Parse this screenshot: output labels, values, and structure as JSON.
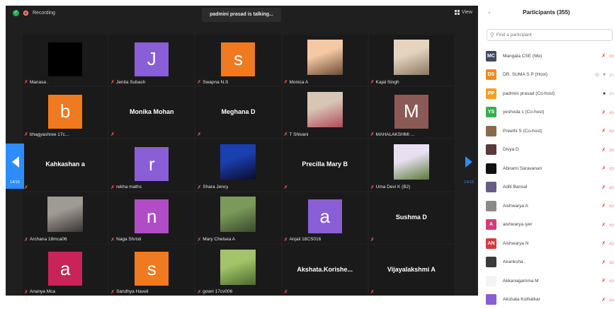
{
  "topbar": {
    "recording": "Recording",
    "talking": "padmini prasad is talking...",
    "view": "View"
  },
  "nav": {
    "left_page": "14/15",
    "right_page": "14/15"
  },
  "tiles": [
    {
      "name": "Manasa .",
      "kind": "avatar",
      "bg": "#000000",
      "letter": ""
    },
    {
      "name": "Jenita Subash",
      "kind": "avatar",
      "bg": "#8a5ed6",
      "letter": "J"
    },
    {
      "name": "Swapna N.S",
      "kind": "avatar",
      "bg": "#f07a1f",
      "letter": "s"
    },
    {
      "name": "Monica A",
      "kind": "photo",
      "p1": "#f4c9a4",
      "p2": "#6b4a35"
    },
    {
      "name": "Kajal Singh",
      "kind": "photo",
      "p1": "#e5d5c0",
      "p2": "#8a7860"
    },
    {
      "name": "bhagyashree 17c...",
      "kind": "avatar",
      "bg": "#f07a1f",
      "letter": "b"
    },
    {
      "name": "",
      "kind": "text",
      "text": "Monika Mohan"
    },
    {
      "name": "",
      "kind": "text",
      "text": "Meghana D"
    },
    {
      "name": "T Shivani",
      "kind": "photo",
      "p1": "#d8c6b4",
      "p2": "#b24a5a"
    },
    {
      "name": "MAHALAKSHMI ...",
      "kind": "avatar",
      "bg": "#8b5a54",
      "letter": "M"
    },
    {
      "name": "",
      "kind": "text",
      "text": "Kahkashan a"
    },
    {
      "name": "rekha maths",
      "kind": "avatar",
      "bg": "#8a5ed6",
      "letter": "r"
    },
    {
      "name": "Shara Jency",
      "kind": "photo",
      "p1": "#1a3fb0",
      "p2": "#0b0b2a"
    },
    {
      "name": "",
      "kind": "text",
      "text": "Precilla Mary B"
    },
    {
      "name": "Uma Devi K (B2)",
      "kind": "photo",
      "p1": "#e8e0f0",
      "p2": "#5a7a3a"
    },
    {
      "name": "Archana 18mca06",
      "kind": "photo",
      "p1": "#a09a94",
      "p2": "#3a3430"
    },
    {
      "name": "Naga Shristi",
      "kind": "avatar",
      "bg": "#b04dc6",
      "letter": "n"
    },
    {
      "name": "Mary Chelsea A",
      "kind": "photo",
      "p1": "#7a9a5a",
      "p2": "#3a4a2a"
    },
    {
      "name": "Anjali 18CS016",
      "kind": "avatar",
      "bg": "#8a5ed6",
      "letter": "a"
    },
    {
      "name": "",
      "kind": "text",
      "text": "Sushma D"
    },
    {
      "name": "Ananya Mca",
      "kind": "avatar",
      "bg": "#c8245a",
      "letter": "a"
    },
    {
      "name": "Sandhya Haveli",
      "kind": "avatar",
      "bg": "#f07a1f",
      "letter": "s"
    },
    {
      "name": "gowri 17cv006",
      "kind": "photo",
      "p1": "#a4c46a",
      "p2": "#4a6a2a"
    },
    {
      "name": "",
      "kind": "text",
      "text": "Akshata.Korishe..."
    },
    {
      "name": "",
      "kind": "text",
      "text": "Vijayalakshmi A"
    }
  ],
  "panel": {
    "title": "Participants (355)",
    "search_placeholder": "Find a participant",
    "participants": [
      {
        "initials": "MC",
        "bg": "#3f4a63",
        "name": "Mangala CSE (Me)",
        "cam": true,
        "more": false,
        "mic": "muted"
      },
      {
        "initials": "DS",
        "bg": "#f08a1f",
        "name": "DR. SUMA S P (Host)",
        "cam": true,
        "more": true,
        "mic": "on"
      },
      {
        "initials": "PP",
        "bg": "#f0a21f",
        "name": "padmini prasad (Co-host)",
        "cam": true,
        "more": false,
        "mic": "on-dark"
      },
      {
        "initials": "YS",
        "bg": "#2eb34f",
        "name": "yeshoda s (Co-host)",
        "cam": true,
        "more": false,
        "mic": "muted"
      },
      {
        "initials": "",
        "bg": "#8a6a4a",
        "name": "Preethi S (Co-host)",
        "cam": true,
        "more": false,
        "mic": "muted"
      },
      {
        "initials": "",
        "bg": "#5a3a3a",
        "name": "Divya D",
        "cam": true,
        "more": false,
        "mic": "muted"
      },
      {
        "initials": "",
        "bg": "#111111",
        "name": "Abirami Saravanan",
        "cam": true,
        "more": false,
        "mic": "muted"
      },
      {
        "initials": "",
        "bg": "#6a5a8a",
        "name": "Aditi Bansal",
        "cam": true,
        "more": false,
        "mic": "muted"
      },
      {
        "initials": "",
        "bg": "#8a8a8a",
        "name": "Aishwarya A",
        "cam": true,
        "more": false,
        "mic": "muted"
      },
      {
        "initials": "A",
        "bg": "#d63a7a",
        "name": "aishwarya iyer",
        "cam": true,
        "more": false,
        "mic": "muted"
      },
      {
        "initials": "AN",
        "bg": "#d83a3a",
        "name": "Aishwarya N",
        "cam": true,
        "more": false,
        "mic": "muted"
      },
      {
        "initials": "",
        "bg": "#3a3a3a",
        "name": "Akanksha .",
        "cam": true,
        "more": false,
        "mic": "muted"
      },
      {
        "initials": "",
        "bg": "#f4f4f4",
        "name": "Akkanagamma M",
        "cam": true,
        "more": false,
        "mic": "muted"
      },
      {
        "initials": "",
        "bg": "#8a5ed6",
        "name": "Akshata Kolhatkar",
        "cam": true,
        "more": false,
        "mic": "muted"
      }
    ]
  }
}
